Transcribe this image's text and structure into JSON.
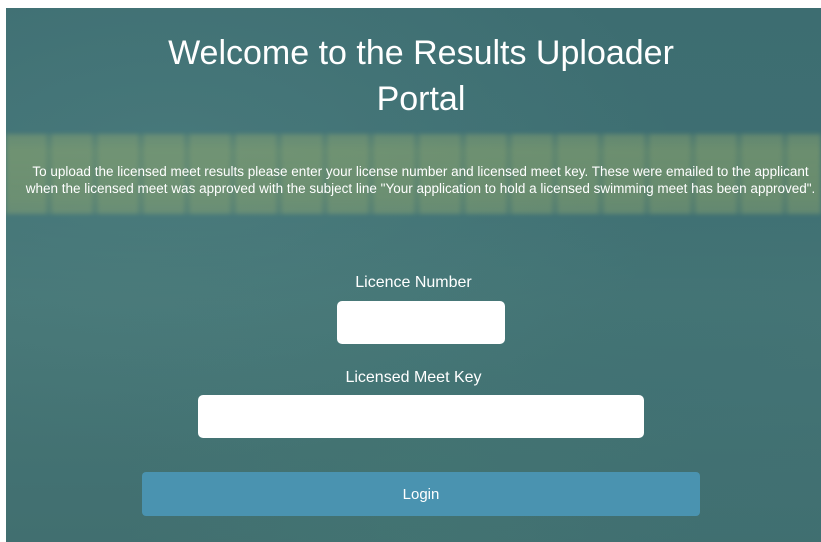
{
  "header": {
    "title_line1": "Welcome to the Results Uploader",
    "title_line2": "Portal"
  },
  "intro": {
    "text": "To upload the licensed meet results please enter your license number and licensed meet key. These were emailed to the applicant when the licensed meet was approved with the subject line \"Your application to hold a licensed swimming meet has been approved\"."
  },
  "form": {
    "licence_number_label": "Licence Number",
    "licence_number_value": "",
    "meet_key_label": "Licensed Meet Key",
    "meet_key_value": "",
    "login_label": "Login"
  },
  "colors": {
    "background": "#3e6f72",
    "button": "#4a93b0",
    "text": "#ffffff"
  }
}
